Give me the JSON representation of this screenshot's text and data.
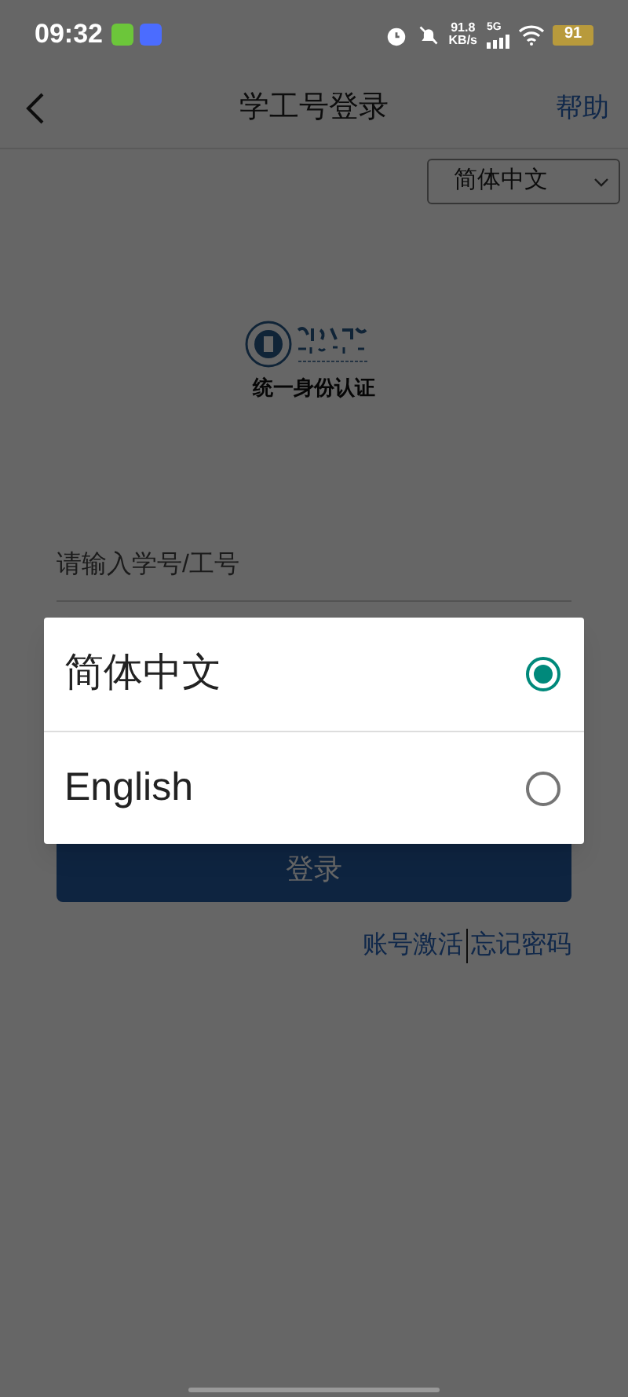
{
  "status_bar": {
    "time": "09:32",
    "network_speed": "91.8",
    "network_unit": "KB/s",
    "network_type": "5G",
    "battery": "91"
  },
  "header": {
    "title": "学工号登录",
    "help": "帮助"
  },
  "language_select": {
    "value": "简体中文"
  },
  "logo": {
    "caption": "统一身份认证"
  },
  "form": {
    "username_placeholder": "请输入学号/工号",
    "login_button": "登录",
    "links": [
      "账号激活",
      "忘记密码"
    ]
  },
  "language_dialog": {
    "options": [
      {
        "label": "简体中文",
        "selected": true
      },
      {
        "label": "English",
        "selected": false
      }
    ]
  }
}
